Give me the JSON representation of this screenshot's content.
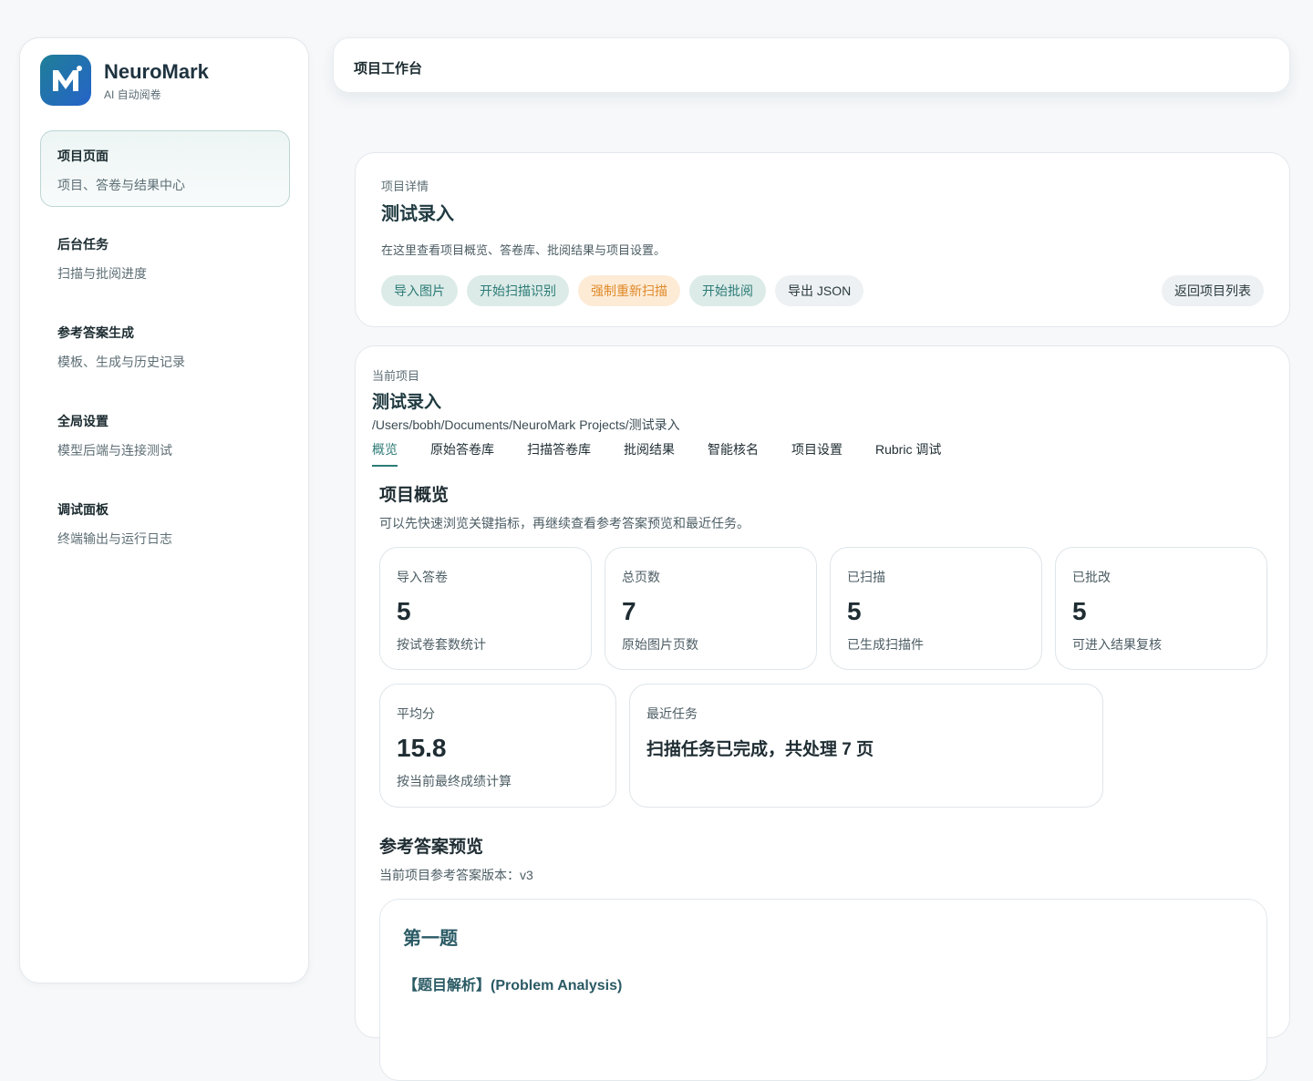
{
  "brand": {
    "name": "NeuroMark",
    "subtitle": "AI 自动阅卷",
    "logo_letter": "M"
  },
  "sidebar": {
    "items": [
      {
        "title": "项目页面",
        "desc": "项目、答卷与结果中心",
        "active": true
      },
      {
        "title": "后台任务",
        "desc": "扫描与批阅进度"
      },
      {
        "title": "参考答案生成",
        "desc": "模板、生成与历史记录"
      },
      {
        "title": "全局设置",
        "desc": "模型后端与连接测试"
      },
      {
        "title": "调试面板",
        "desc": "终端输出与运行日志"
      }
    ]
  },
  "topbar": {
    "title": "项目工作台"
  },
  "detail": {
    "eyebrow": "项目详情",
    "title": "测试录入",
    "desc": "在这里查看项目概览、答卷库、批阅结果与项目设置。",
    "actions": {
      "import_images": "导入图片",
      "start_scan": "开始扫描识别",
      "force_rescan": "强制重新扫描",
      "start_grading": "开始批阅",
      "export_json": "导出 JSON"
    },
    "back": "返回项目列表"
  },
  "project": {
    "eyebrow": "当前项目",
    "title": "测试录入",
    "path": "/Users/bobh/Documents/NeuroMark Projects/测试录入",
    "tabs": [
      "概览",
      "原始答卷库",
      "扫描答卷库",
      "批阅结果",
      "智能核名",
      "项目设置",
      "Rubric 调试"
    ],
    "active_tab": "概览"
  },
  "overview": {
    "title": "项目概览",
    "desc": "可以先快速浏览关键指标，再继续查看参考答案预览和最近任务。",
    "stats": [
      {
        "label": "导入答卷",
        "value": "5",
        "note": "按试卷套数统计"
      },
      {
        "label": "总页数",
        "value": "7",
        "note": "原始图片页数"
      },
      {
        "label": "已扫描",
        "value": "5",
        "note": "已生成扫描件"
      },
      {
        "label": "已批改",
        "value": "5",
        "note": "可进入结果复核"
      },
      {
        "label": "平均分",
        "value": "15.8",
        "note": "按当前最终成绩计算"
      }
    ],
    "recent": {
      "label": "最近任务",
      "text": "扫描任务已完成，共处理 7 页"
    }
  },
  "answer_preview": {
    "title": "参考答案预览",
    "version": "当前项目参考答案版本：v3",
    "question_title": "第一题",
    "section_heading": "【题目解析】(Problem Analysis)"
  },
  "colors": {
    "accent": "#2c7b76",
    "warning": "#e08a2a",
    "brand_start": "#1f7f97",
    "brand_end": "#2563c9"
  }
}
